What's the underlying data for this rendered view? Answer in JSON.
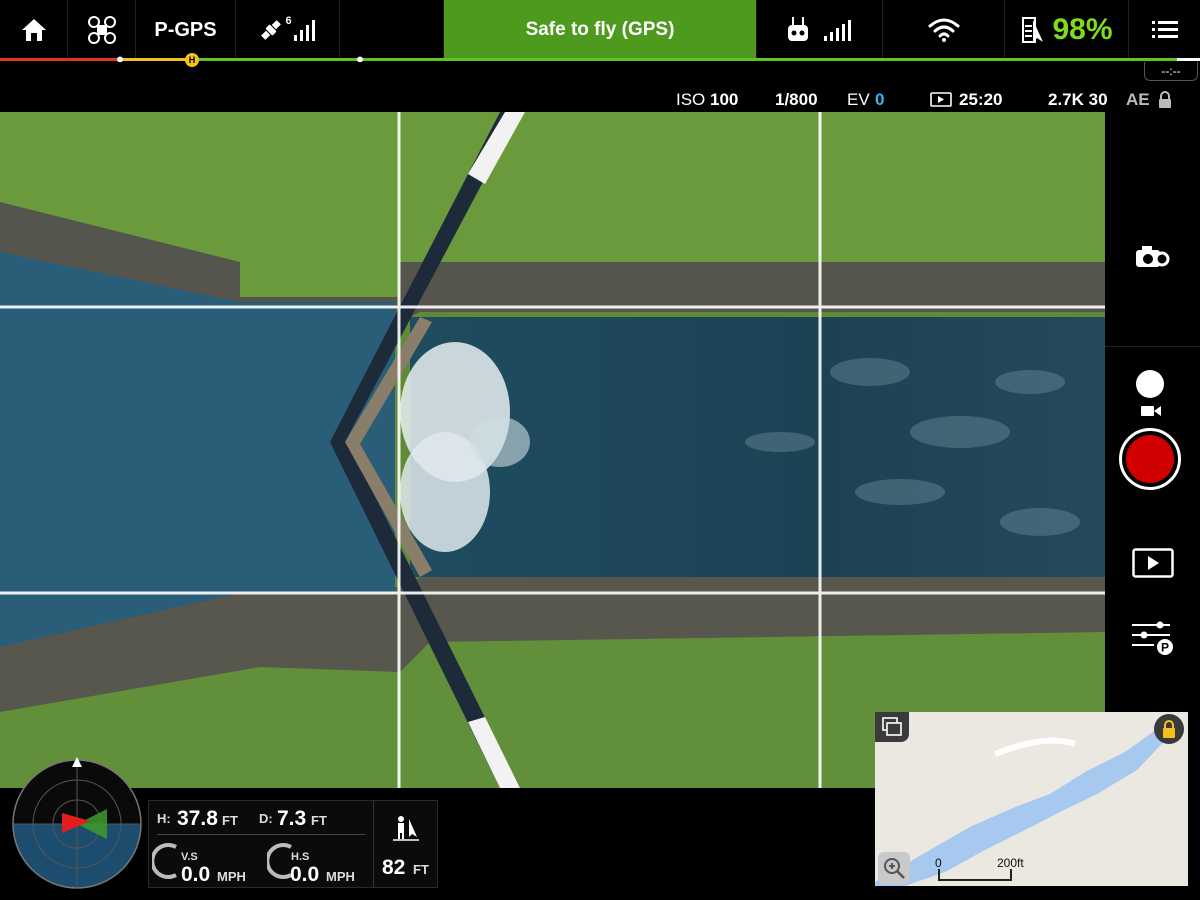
{
  "topbar": {
    "home_icon": "home-icon",
    "aircraft_icon": "drone-icon",
    "flight_mode": "P-GPS",
    "satellite_count": "6",
    "status_text": "Safe to fly (GPS)",
    "battery_percent": "98%",
    "status_color": "#4e9a1e",
    "battery_color": "#7ddc1f"
  },
  "flight_bar": {
    "home_marker": "H",
    "remaining_time": "--:--"
  },
  "camera": {
    "iso_label": "ISO",
    "iso_value": "100",
    "shutter": "1/800",
    "ev_label": "EV",
    "ev_value": "0",
    "remaining_rec_time": "25:20",
    "resolution_fps": "2.7K 30",
    "ae_label": "AE",
    "ev_color": "#35b6f0"
  },
  "right_panel": {
    "camera_settings_icon": "camera-settings-icon",
    "photo_mode_icon": "photo-mode-icon",
    "video_mode_icon": "video-mode-icon",
    "record_color": "#d10000",
    "playback_icon": "playback-icon",
    "flight_mode_settings_icon": "flight-settings-icon"
  },
  "telemetry": {
    "h_label": "H:",
    "h_value": "37.8",
    "h_unit": "FT",
    "d_label": "D:",
    "d_value": "7.3",
    "d_unit": "FT",
    "vs_label": "V.S",
    "vs_value": "0.0",
    "vs_unit": "MPH",
    "hs_label": "H.S",
    "hs_value": "0.0",
    "hs_unit": "MPH",
    "vps_value": "82",
    "vps_unit": "FT"
  },
  "minimap": {
    "scale_start": "0",
    "scale_end": "200ft"
  }
}
